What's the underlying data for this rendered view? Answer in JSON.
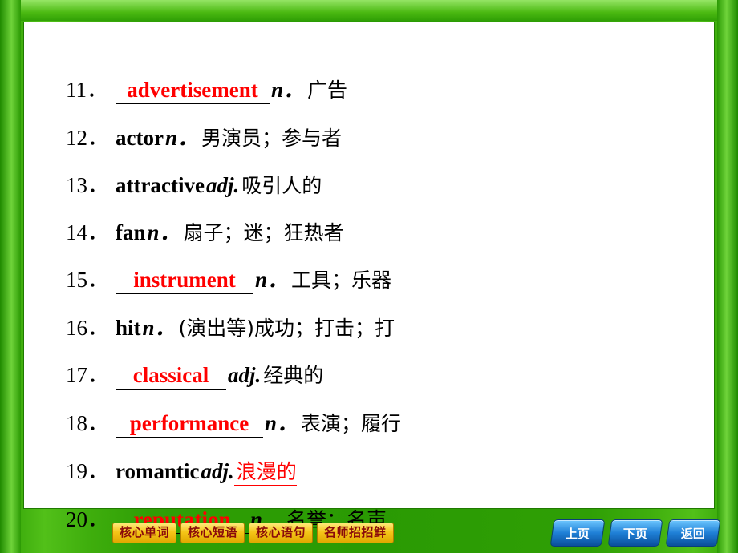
{
  "slide": {
    "items": [
      {
        "num": "11．",
        "blank": "advertisement",
        "word": "",
        "pos": "n．",
        "cn": "广告",
        "cn_red": ""
      },
      {
        "num": "12．",
        "blank": "",
        "word": "actor",
        "pos": "n．",
        "cn": "男演员；参与者",
        "cn_red": ""
      },
      {
        "num": "13．",
        "blank": "",
        "word": "attractive",
        "pos": "adj.",
        "cn": "吸引人的",
        "cn_red": ""
      },
      {
        "num": "14．",
        "blank": "",
        "word": "fan",
        "pos": "n．",
        "cn": "扇子；迷；狂热者",
        "cn_red": ""
      },
      {
        "num": "15．",
        "blank": "instrument",
        "word": "",
        "pos": "n．",
        "cn": "工具；乐器",
        "cn_red": ""
      },
      {
        "num": "16．",
        "blank": "",
        "word": "hit",
        "pos": "n．",
        "cn": "(演出等)成功；打击；打",
        "cn_red": ""
      },
      {
        "num": "17．",
        "blank": "classical",
        "word": "",
        "pos": "adj.",
        "cn": "经典的",
        "cn_red": ""
      },
      {
        "num": "18．",
        "blank": "performance",
        "word": "",
        "pos": "n．",
        "cn": "表演；履行",
        "cn_red": ""
      },
      {
        "num": "19．",
        "blank": "",
        "word": "romantic",
        "pos": "adj.",
        "cn": "",
        "cn_red": "浪漫的"
      },
      {
        "num": "20．",
        "blank": "reputation",
        "word": "",
        "pos": "n．",
        "cn": "名誉；名声",
        "cn_red": ""
      }
    ]
  },
  "bottom": {
    "tabs": [
      {
        "label": "核心单词"
      },
      {
        "label": "核心短语"
      },
      {
        "label": "核心语句"
      },
      {
        "label": "名师招招鲜"
      }
    ],
    "nav": [
      {
        "label": "上页"
      },
      {
        "label": "下页"
      },
      {
        "label": "返回"
      }
    ]
  },
  "colors": {
    "background_green": "#2f9f05",
    "answer_red": "#ff0000",
    "tab_yellow": "#f5c518",
    "nav_blue": "#1f7fd6"
  }
}
